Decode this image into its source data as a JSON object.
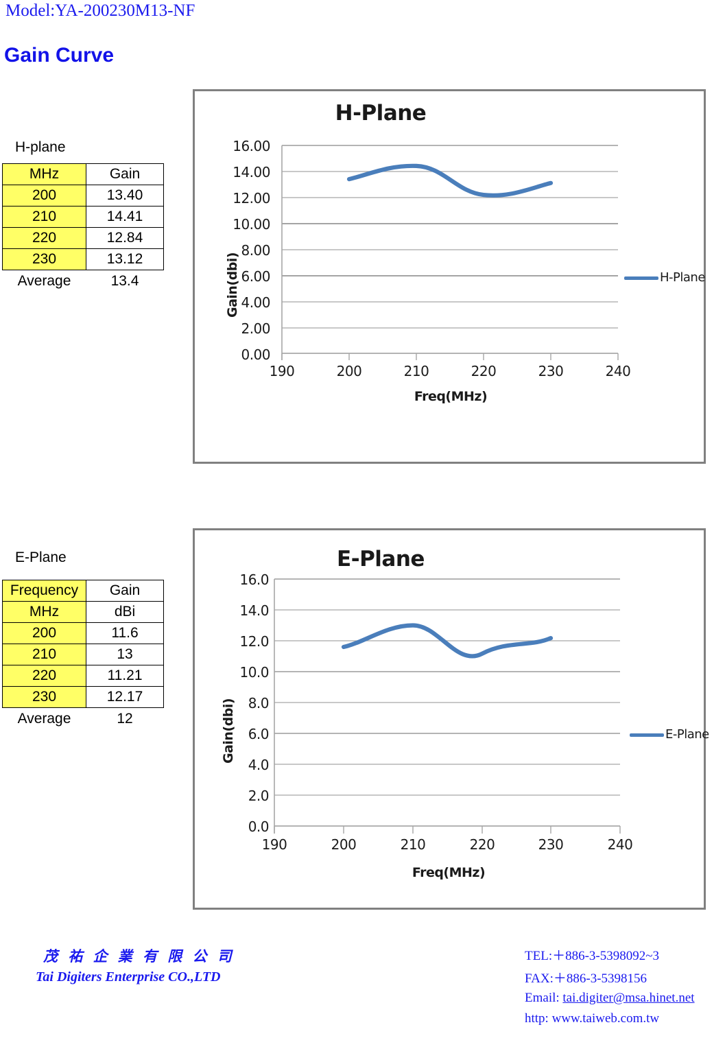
{
  "header": {
    "model": "Model:YA-200230M13-NF",
    "section_title": "Gain Curve"
  },
  "h_plane_table": {
    "caption": "H-plane",
    "columns": [
      "MHz",
      "Gain"
    ],
    "rows": [
      [
        "200",
        "13.40"
      ],
      [
        "210",
        "14.41"
      ],
      [
        "220",
        "12.84"
      ],
      [
        "230",
        "13.12"
      ]
    ],
    "average_label": "Average",
    "average_value": "13.4"
  },
  "e_plane_table": {
    "caption": "E-Plane",
    "columns": [
      "Frequency",
      "Gain"
    ],
    "units": [
      "MHz",
      "dBi"
    ],
    "rows": [
      [
        "200",
        "11.6"
      ],
      [
        "210",
        "13"
      ],
      [
        "220",
        "11.21"
      ],
      [
        "230",
        "12.17"
      ]
    ],
    "average_label": "Average",
    "average_value": "12"
  },
  "chart_data": [
    {
      "type": "line",
      "title": "H-Plane",
      "xlabel": "Freq(MHz)",
      "ylabel": "Gain(dbi)",
      "x": [
        200,
        210,
        220,
        230
      ],
      "values": [
        13.4,
        14.41,
        12.84,
        13.12
      ],
      "series": [
        {
          "name": "H-Plane",
          "values": [
            13.4,
            14.41,
            12.84,
            13.12
          ]
        }
      ],
      "legend": [
        "H-Plane"
      ],
      "legend_position": "right",
      "xlim": [
        190,
        240
      ],
      "ylim": [
        0.0,
        16.0
      ],
      "xticks": [
        "190",
        "200",
        "210",
        "220",
        "230",
        "240"
      ],
      "yticks": [
        "16.00",
        "14.00",
        "12.00",
        "10.00",
        "8.00",
        "6.00",
        "4.00",
        "2.00",
        "0.00"
      ],
      "grid": true,
      "line_color": "#4A7EBB",
      "smooth": true
    },
    {
      "type": "line",
      "title": "E-Plane",
      "xlabel": "Freq(MHz)",
      "ylabel": "Gain(dbi)",
      "x": [
        200,
        210,
        220,
        230
      ],
      "values": [
        11.6,
        13.0,
        11.21,
        12.17
      ],
      "series": [
        {
          "name": "E-Plane",
          "values": [
            11.6,
            13.0,
            11.21,
            12.17
          ]
        }
      ],
      "legend": [
        "E-Plane"
      ],
      "legend_position": "right",
      "xlim": [
        190,
        240
      ],
      "ylim": [
        0.0,
        16.0
      ],
      "xticks": [
        "190",
        "200",
        "210",
        "220",
        "230",
        "240"
      ],
      "yticks": [
        "16.0",
        "14.0",
        "12.0",
        "10.0",
        "8.0",
        "6.0",
        "4.0",
        "2.0",
        "0.0"
      ],
      "grid": true,
      "line_color": "#4A7EBB",
      "smooth": true
    }
  ],
  "footer": {
    "company_cn": "茂 祐 企 業 有 限 公 司",
    "company_en": "Tai Digiters Enterprise CO.,LTD",
    "tel": "TEL:＋886-3-5398092~3",
    "fax": "FAX:＋886-3-5398156",
    "email_prefix": "Email: ",
    "email": "tai.digiter@msa.hinet.net",
    "http_prefix": "http: ",
    "website": "www.taiweb.com.tw"
  }
}
